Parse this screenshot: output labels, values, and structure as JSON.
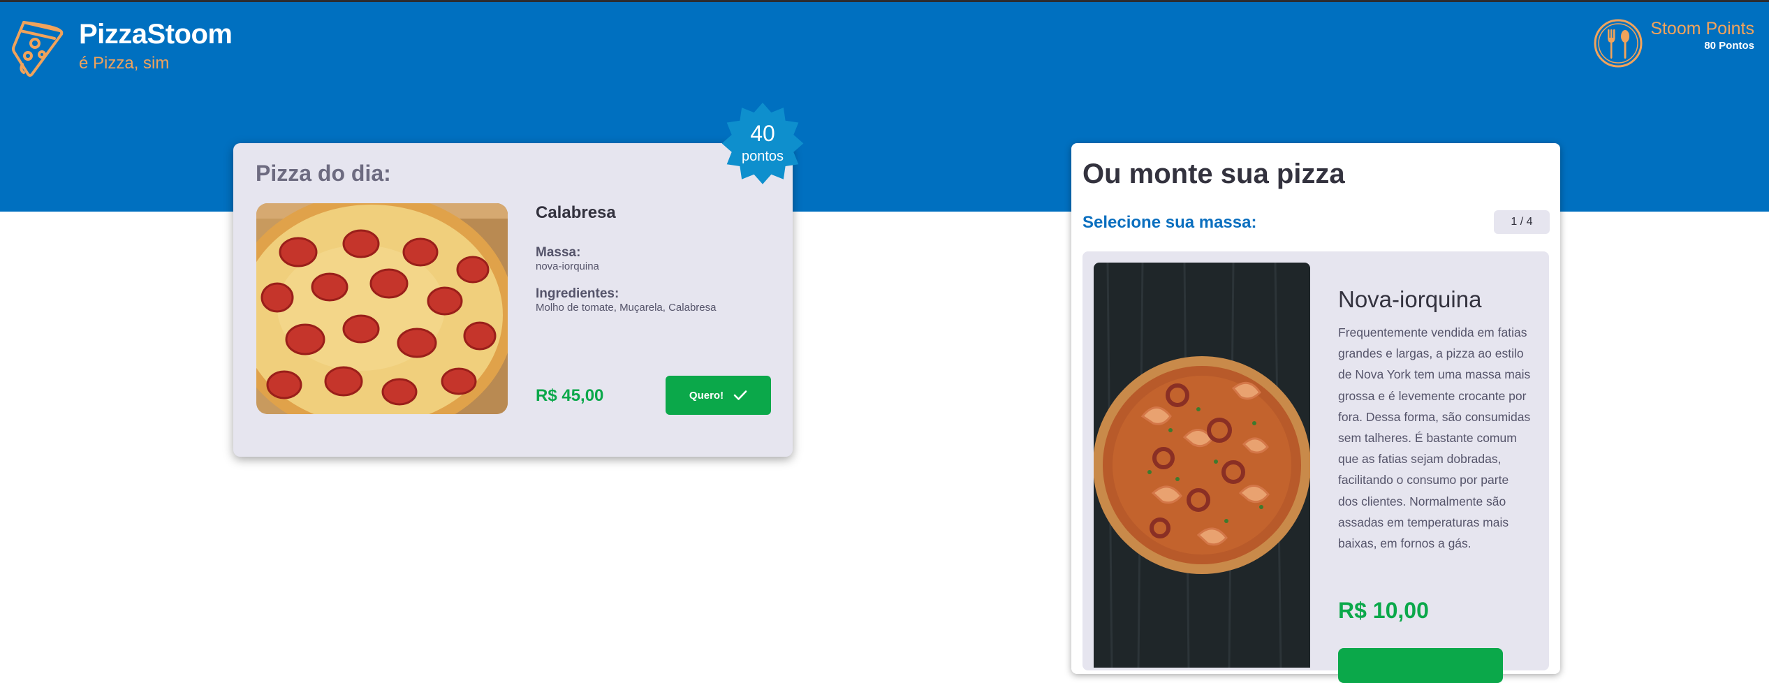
{
  "header": {
    "brand": "PizzaStoom",
    "tagline": "é Pizza, sim",
    "logo_icon": "pizza-slice-icon",
    "points_title": "Stoom Points",
    "points_value": "80 Pontos",
    "points_icon": "fork-spoon-icon"
  },
  "pizza_do_dia": {
    "title": "Pizza do dia:",
    "name": "Calabresa",
    "massa_label": "Massa:",
    "massa_value": "nova-iorquina",
    "ingredientes_label": "Ingredientes:",
    "ingredientes_value": "Molho de tomate, Muçarela, Calabresa",
    "price": "R$ 45,00",
    "button_label": "Quero!",
    "button_icon": "check-icon",
    "badge_value": "40",
    "badge_label": "pontos"
  },
  "monte": {
    "title": "Ou monte sua pizza",
    "step_label": "Selecione sua massa:",
    "step_counter": "1 / 4",
    "option": {
      "name": "Nova-iorquina",
      "description": "Frequentemente vendida em fatias grandes e largas, a pizza ao estilo de Nova York tem uma massa mais grossa e é levemente crocante por fora. Dessa forma, são consumidas sem talheres. É bastante comum que as fatias sejam dobradas, facilitando o consumo por parte dos clientes. Normalmente são assadas em temperaturas mais baixas, em fornos a gás.",
      "price": "R$ 10,00"
    }
  },
  "colors": {
    "banner": "#0070c0",
    "accent_orange": "#f1a35b",
    "green": "#0ba84a",
    "card_bg": "#e6e5ef",
    "badge": "#0e8fcd"
  }
}
